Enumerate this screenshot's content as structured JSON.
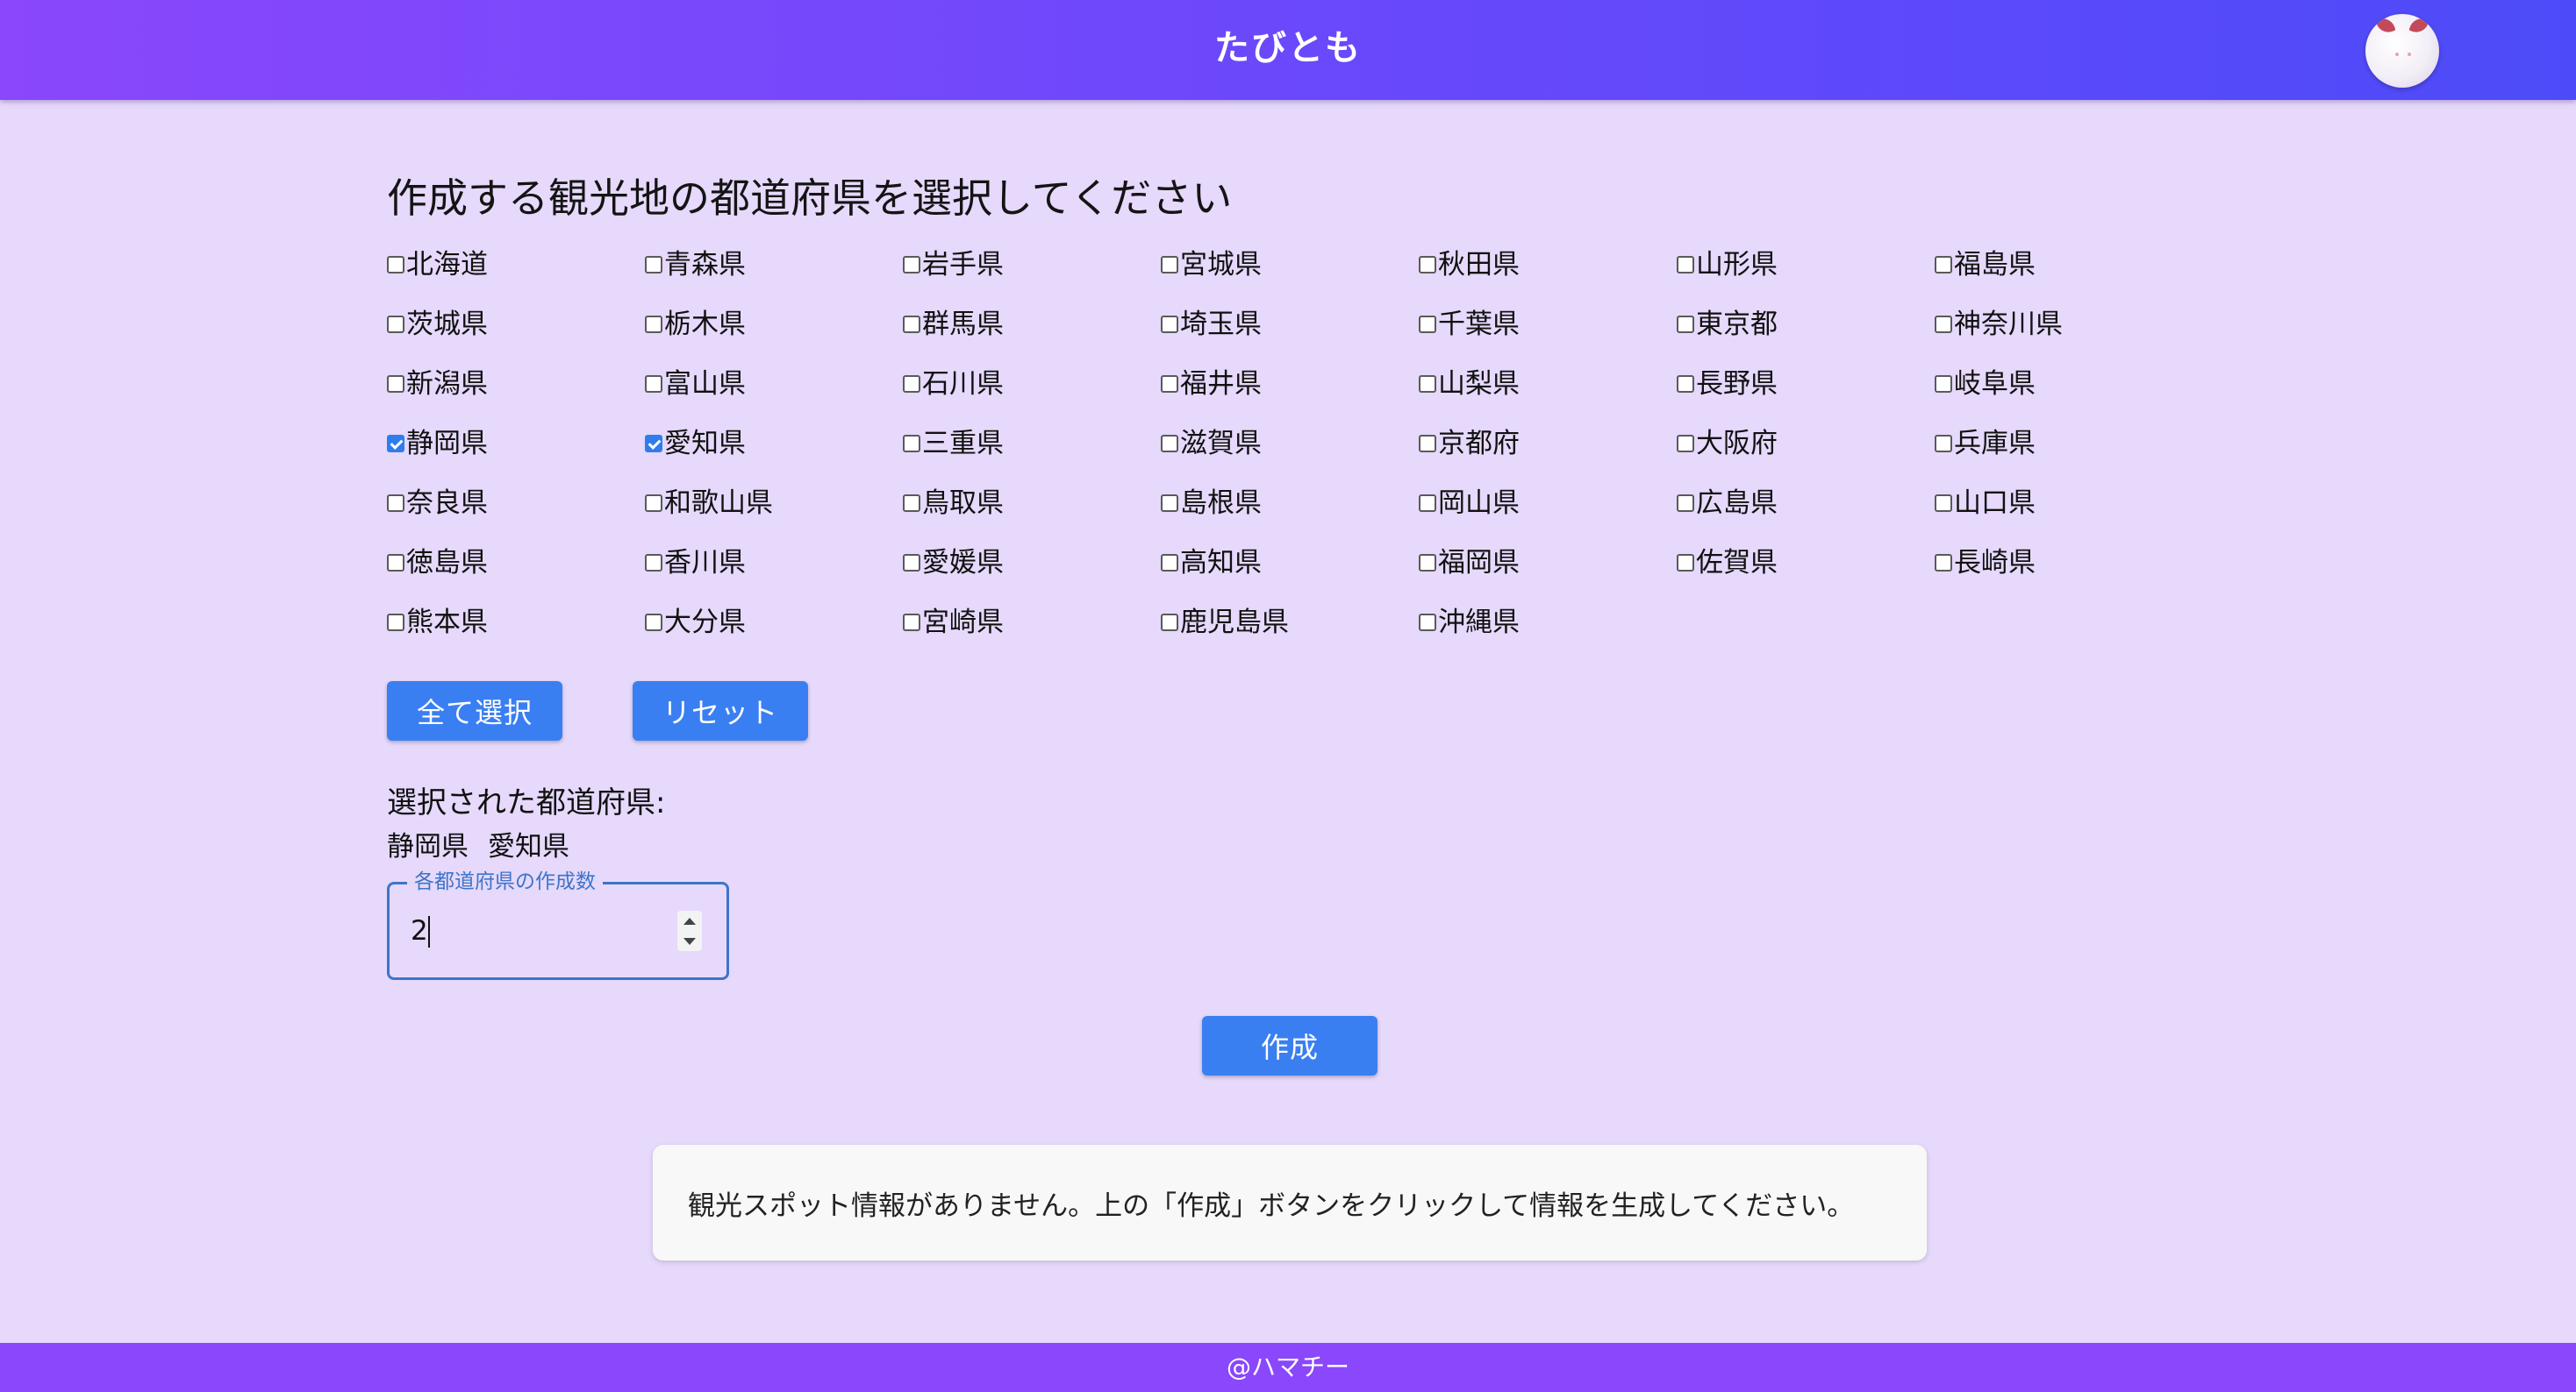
{
  "header": {
    "app_title": "たびとも",
    "avatar_icon": "round-white-cat-mascot-icon"
  },
  "main": {
    "heading": "作成する観光地の都道府県を選択してください",
    "prefectures": [
      {
        "name": "北海道",
        "checked": false
      },
      {
        "name": "青森県",
        "checked": false
      },
      {
        "name": "岩手県",
        "checked": false
      },
      {
        "name": "宮城県",
        "checked": false
      },
      {
        "name": "秋田県",
        "checked": false
      },
      {
        "name": "山形県",
        "checked": false
      },
      {
        "name": "福島県",
        "checked": false
      },
      {
        "name": "茨城県",
        "checked": false
      },
      {
        "name": "栃木県",
        "checked": false
      },
      {
        "name": "群馬県",
        "checked": false
      },
      {
        "name": "埼玉県",
        "checked": false
      },
      {
        "name": "千葉県",
        "checked": false
      },
      {
        "name": "東京都",
        "checked": false
      },
      {
        "name": "神奈川県",
        "checked": false
      },
      {
        "name": "新潟県",
        "checked": false
      },
      {
        "name": "富山県",
        "checked": false
      },
      {
        "name": "石川県",
        "checked": false
      },
      {
        "name": "福井県",
        "checked": false
      },
      {
        "name": "山梨県",
        "checked": false
      },
      {
        "name": "長野県",
        "checked": false
      },
      {
        "name": "岐阜県",
        "checked": false
      },
      {
        "name": "静岡県",
        "checked": true
      },
      {
        "name": "愛知県",
        "checked": true
      },
      {
        "name": "三重県",
        "checked": false
      },
      {
        "name": "滋賀県",
        "checked": false
      },
      {
        "name": "京都府",
        "checked": false
      },
      {
        "name": "大阪府",
        "checked": false
      },
      {
        "name": "兵庫県",
        "checked": false
      },
      {
        "name": "奈良県",
        "checked": false
      },
      {
        "name": "和歌山県",
        "checked": false
      },
      {
        "name": "鳥取県",
        "checked": false
      },
      {
        "name": "島根県",
        "checked": false
      },
      {
        "name": "岡山県",
        "checked": false
      },
      {
        "name": "広島県",
        "checked": false
      },
      {
        "name": "山口県",
        "checked": false
      },
      {
        "name": "徳島県",
        "checked": false
      },
      {
        "name": "香川県",
        "checked": false
      },
      {
        "name": "愛媛県",
        "checked": false
      },
      {
        "name": "高知県",
        "checked": false
      },
      {
        "name": "福岡県",
        "checked": false
      },
      {
        "name": "佐賀県",
        "checked": false
      },
      {
        "name": "長崎県",
        "checked": false
      },
      {
        "name": "熊本県",
        "checked": false
      },
      {
        "name": "大分県",
        "checked": false
      },
      {
        "name": "宮崎県",
        "checked": false
      },
      {
        "name": "鹿児島県",
        "checked": false
      },
      {
        "name": "沖縄県",
        "checked": false
      }
    ],
    "select_all_label": "全て選択",
    "reset_label": "リセット",
    "selected_label": "選択された都道府県:",
    "selected_list": [
      "静岡県",
      "愛知県"
    ],
    "count_field": {
      "label": "各都道府県の作成数",
      "value": "2"
    },
    "create_label": "作成",
    "empty_message": "観光スポット情報がありません。上の「作成」ボタンをクリックして情報を生成してください。"
  },
  "footer": {
    "text": "@ハマチー"
  },
  "colors": {
    "background": "#e6d9fb",
    "header_start": "#8a47fb",
    "header_end": "#4d4bf9",
    "button": "#3a7ff2",
    "footer": "#8a47fb",
    "field_border": "#3f74c9"
  }
}
